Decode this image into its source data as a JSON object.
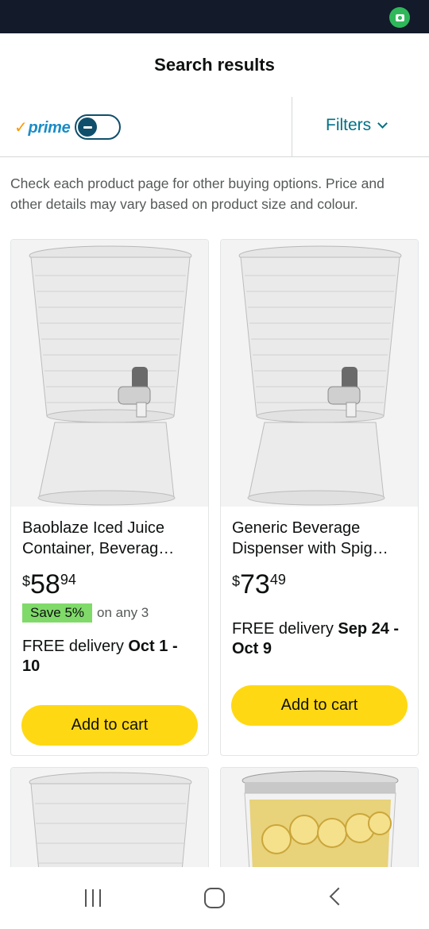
{
  "header": {
    "title": "Search results"
  },
  "filter_bar": {
    "prime_label": "prime",
    "prime_toggle_on": false,
    "filters_label": "Filters"
  },
  "notice": "Check each product page for other buying options. Price and other details may vary based on product size and colour.",
  "products": [
    {
      "title": "Baoblaze Iced Juice Container, Beverag…",
      "price_symbol": "$",
      "price_whole": "58",
      "price_fraction": "94",
      "save_badge": "Save 5%",
      "save_note": "on any 3",
      "delivery_prefix": "FREE delivery ",
      "delivery_date": "Oct 1 - 10",
      "cart_label": "Add to cart"
    },
    {
      "title": "Generic Beverage Dispenser with Spig…",
      "price_symbol": "$",
      "price_whole": "73",
      "price_fraction": "49",
      "delivery_prefix": "FREE delivery ",
      "delivery_date": "Sep 24 - Oct 9",
      "cart_label": "Add to cart"
    }
  ],
  "colors": {
    "accent_link": "#007185",
    "cart_button": "#ffd814",
    "save_badge": "#7fda69",
    "status_bar": "#131a2a"
  }
}
